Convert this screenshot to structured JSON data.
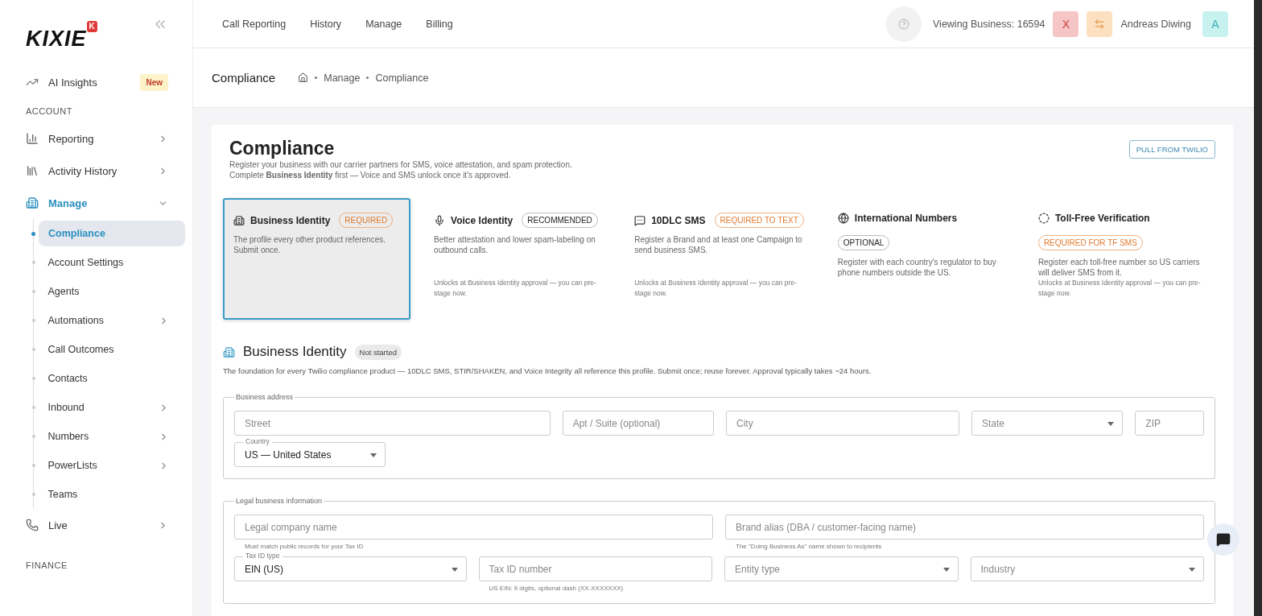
{
  "sidebar": {
    "logo": "KIXIE",
    "logo_badge": "K",
    "top_item": {
      "label": "AI Insights",
      "badge": "New"
    },
    "sections": [
      {
        "heading": "ACCOUNT",
        "items": [
          {
            "label": "Reporting",
            "has_arrow": true,
            "expanded": false
          },
          {
            "label": "Activity History",
            "has_arrow": true,
            "expanded": false
          },
          {
            "label": "Manage",
            "has_arrow": true,
            "expanded": true,
            "children": [
              {
                "label": "Compliance",
                "selected": true,
                "has_arrow": false
              },
              {
                "label": "Account Settings",
                "selected": false,
                "has_arrow": false
              },
              {
                "label": "Agents",
                "selected": false,
                "has_arrow": false
              },
              {
                "label": "Automations",
                "selected": false,
                "has_arrow": true
              },
              {
                "label": "Call Outcomes",
                "selected": false,
                "has_arrow": false
              },
              {
                "label": "Contacts",
                "selected": false,
                "has_arrow": false
              },
              {
                "label": "Inbound",
                "selected": false,
                "has_arrow": true
              },
              {
                "label": "Numbers",
                "selected": false,
                "has_arrow": true
              },
              {
                "label": "PowerLists",
                "selected": false,
                "has_arrow": true
              },
              {
                "label": "Teams",
                "selected": false,
                "has_arrow": false
              }
            ]
          },
          {
            "label": "Live",
            "has_arrow": true,
            "expanded": false
          }
        ]
      },
      {
        "heading": "FINANCE"
      }
    ]
  },
  "topnav": {
    "links": [
      "Call Reporting",
      "History",
      "Manage",
      "Billing"
    ],
    "viewing": "Viewing Business: 16594",
    "exit": "X",
    "user": "Andreas Diwing",
    "avatar": "A"
  },
  "breadcrumb": {
    "title": "Compliance",
    "path": [
      "Manage",
      "Compliance"
    ]
  },
  "page": {
    "title": "Compliance",
    "intro": [
      "Register your business with our carrier partners for SMS, voice attestation, and spam protection.",
      "Complete **Business Identity** first — Voice and SMS unlock once it's approved."
    ],
    "action": "PULL FROM TWILIO",
    "products": [
      {
        "title": "Business Identity",
        "badge": "REQUIRED",
        "required": true,
        "badge_below": false,
        "selected": true,
        "description": "The profile every other product references. Submit once."
      },
      {
        "title": "Voice Identity",
        "badge": "RECOMMENDED",
        "required": false,
        "badge_below": false,
        "selected": false,
        "description": "Better attestation and lower spam-labeling on outbound calls.",
        "note": "Unlocks at Business Identity approval — you can pre-stage now."
      },
      {
        "title": "10DLC SMS",
        "badge": "REQUIRED TO TEXT",
        "required": true,
        "badge_below": false,
        "selected": false,
        "description": "Register a Brand and at least one Campaign to send business SMS.",
        "note": "Unlocks at Business Identity approval — you can pre-stage now."
      },
      {
        "title": "International Numbers",
        "badge": "OPTIONAL",
        "required": false,
        "badge_below": true,
        "selected": false,
        "description": "Register with each country's regulator to buy phone numbers outside the US."
      },
      {
        "title": "Toll-Free Verification",
        "badge": "REQUIRED FOR TF SMS",
        "required": true,
        "badge_below": true,
        "selected": false,
        "description": "Register each toll-free number so US carriers will deliver SMS from it.",
        "note": "Unlocks at Business Identity approval — you can pre-stage now."
      }
    ],
    "section": {
      "title": "Business Identity",
      "status": "Not started",
      "description": "The foundation for every Twilio compliance product — 10DLC SMS, STIR/SHAKEN, and Voice Integrity all reference this profile. Submit once; reuse forever. Approval typically takes ~24 hours.",
      "groups": [
        {
          "legend": "Business address",
          "fields": [
            {
              "kind": "text",
              "placeholder": "Street"
            },
            {
              "kind": "text",
              "placeholder": "Apt / Suite (optional)"
            },
            {
              "kind": "text",
              "placeholder": "City"
            },
            {
              "kind": "select",
              "placeholder": "State"
            },
            {
              "kind": "text",
              "placeholder": "ZIP"
            },
            {
              "kind": "select",
              "label": "Country",
              "value": "US — United States"
            }
          ]
        },
        {
          "legend": "Legal business information",
          "fields": [
            {
              "kind": "text",
              "placeholder": "Legal company name",
              "helper": "Must match public records for your Tax ID"
            },
            {
              "kind": "text",
              "placeholder": "Brand alias (DBA / customer-facing name)",
              "helper": "The \"Doing Business As\" name shown to recipients"
            },
            {
              "kind": "select",
              "label": "Tax ID type",
              "value": "EIN (US)"
            },
            {
              "kind": "text",
              "placeholder": "Tax ID number",
              "helper": "US EIN: 9 digits, optional dash (XX-XXXXXXX)"
            },
            {
              "kind": "select",
              "placeholder": "Entity type"
            },
            {
              "kind": "select",
              "placeholder": "Industry"
            }
          ]
        }
      ]
    }
  }
}
